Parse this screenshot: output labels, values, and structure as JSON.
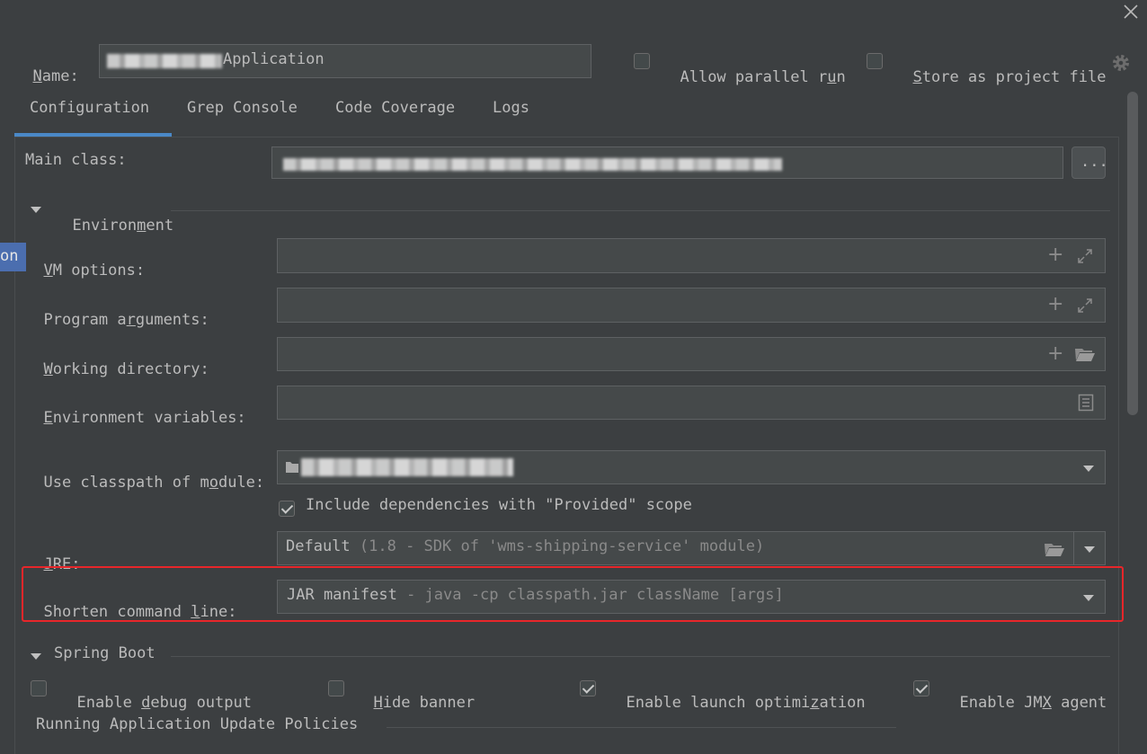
{
  "header": {
    "name_label_prefix": "N",
    "name_label_rest": "ame:",
    "name_value": "Application",
    "allow_parallel_pre": "Allow parallel r",
    "allow_parallel_u": "u",
    "allow_parallel_post": "n",
    "store_project_u": "S",
    "store_project_rest": "tore as project file"
  },
  "tabs": [
    "Configuration",
    "Grep Console",
    "Code Coverage",
    "Logs"
  ],
  "form": {
    "main_class_label": "Main class:",
    "browse_label": "...",
    "environment_pre": "Environ",
    "environment_u": "m",
    "environment_post": "ent",
    "side_tag": "on",
    "vm_options_u": "V",
    "vm_options_rest": "M options:",
    "program_args_pre": "Program a",
    "program_args_u": "r",
    "program_args_post": "guments:",
    "working_dir_u": "W",
    "working_dir_rest": "orking directory:",
    "env_vars_u": "E",
    "env_vars_rest": "nvironment variables:",
    "classpath_pre": "Use classpath of m",
    "classpath_u": "o",
    "classpath_post": "dule:",
    "include_deps": "Include dependencies with \"Provided\" scope",
    "jre_u": "J",
    "jre_rest": "RE:",
    "jre_value": "Default",
    "jre_hint": "(1.8 - SDK of 'wms-shipping-service' module)",
    "shorten_pre": "Shorten command ",
    "shorten_u": "l",
    "shorten_post": "ine:",
    "shorten_value": "JAR manifest",
    "shorten_hint": "- java -cp classpath.jar className [args]"
  },
  "spring_boot": {
    "title": "Spring Boot",
    "debug_pre": "Enable ",
    "debug_u": "d",
    "debug_post": "ebug output",
    "hide_u": "H",
    "hide_rest": "ide banner",
    "launch_pre": "Enable launch optimi",
    "launch_u": "z",
    "launch_post": "ation",
    "jmx_pre": "Enable JM",
    "jmx_u": "X",
    "jmx_post": " agent",
    "policies_title": "Running Application Update Policies"
  },
  "colors": {
    "background": "#3c3f41",
    "active_tab": "#4a88c7",
    "highlight": "#e8262a"
  }
}
